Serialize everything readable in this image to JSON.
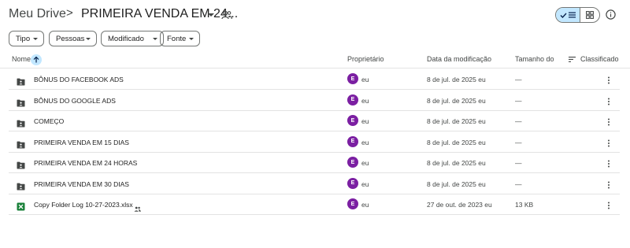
{
  "breadcrumb": {
    "root": "Meu Drive",
    "separator": ">",
    "current": "PRIMEIRA VENDA EM 24..."
  },
  "view_toggle": {
    "active": "list"
  },
  "filters": {
    "tipo": "Tipo",
    "pessoas": "Pessoas",
    "modificado": "Modificado",
    "fonte": "Fonte"
  },
  "columns": {
    "nome": "Nome",
    "proprietario": "Proprietário",
    "data": "Data da modificação",
    "tamanho": "Tamanho do",
    "classificado": "Classificado"
  },
  "sort": {
    "column": "Nome",
    "direction": "ascending"
  },
  "colors": {
    "accent": "#c2e7ff",
    "avatar": "#7b1fa2",
    "xlsx": "#188038",
    "folder": "#444746"
  },
  "files": [
    {
      "name": "BÔNUS DO FACEBOOK ADS",
      "icon": "shared-folder-icon",
      "owner_initial": "E",
      "owner": "eu",
      "modified": "8 de jul. de 2025 eu",
      "size": "—",
      "shared": false
    },
    {
      "name": "BÔNUS DO GOOGLE ADS",
      "icon": "shared-folder-icon",
      "owner_initial": "E",
      "owner": "eu",
      "modified": "8 de jul. de 2025 eu",
      "size": "—",
      "shared": false
    },
    {
      "name": "COMEÇO",
      "icon": "shared-folder-icon",
      "owner_initial": "E",
      "owner": "eu",
      "modified": "8 de jul. de 2025 eu",
      "size": "—",
      "shared": false
    },
    {
      "name": "PRIMEIRA VENDA EM 15 DIAS",
      "icon": "shared-folder-icon",
      "owner_initial": "E",
      "owner": "eu",
      "modified": "8 de jul. de 2025 eu",
      "size": "—",
      "shared": false
    },
    {
      "name": "PRIMEIRA VENDA EM 24 HORAS",
      "icon": "shared-folder-icon",
      "owner_initial": "E",
      "owner": "eu",
      "modified": "8 de jul. de 2025 eu",
      "size": "—",
      "shared": false
    },
    {
      "name": "PRIMEIRA VENDA EM 30 DIAS",
      "icon": "shared-folder-icon",
      "owner_initial": "E",
      "owner": "eu",
      "modified": "8 de jul. de 2025 eu",
      "size": "—",
      "shared": false
    },
    {
      "name": "Copy Folder Log 10-27-2023.xlsx",
      "icon": "excel-file-icon",
      "owner_initial": "E",
      "owner": "eu",
      "modified": "27 de out. de 2023 eu",
      "size": "13 KB",
      "shared": true
    }
  ]
}
